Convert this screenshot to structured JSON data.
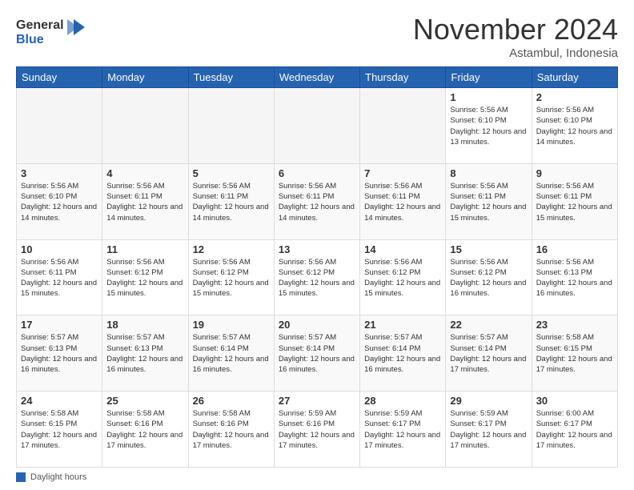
{
  "header": {
    "logo_general": "General",
    "logo_blue": "Blue",
    "month_title": "November 2024",
    "subtitle": "Astambul, Indonesia"
  },
  "days_of_week": [
    "Sunday",
    "Monday",
    "Tuesday",
    "Wednesday",
    "Thursday",
    "Friday",
    "Saturday"
  ],
  "weeks": [
    [
      {
        "day": "",
        "empty": true
      },
      {
        "day": "",
        "empty": true
      },
      {
        "day": "",
        "empty": true
      },
      {
        "day": "",
        "empty": true
      },
      {
        "day": "",
        "empty": true
      },
      {
        "day": "1",
        "sunrise": "Sunrise: 5:56 AM",
        "sunset": "Sunset: 6:10 PM",
        "daylight": "Daylight: 12 hours and 13 minutes."
      },
      {
        "day": "2",
        "sunrise": "Sunrise: 5:56 AM",
        "sunset": "Sunset: 6:10 PM",
        "daylight": "Daylight: 12 hours and 14 minutes."
      }
    ],
    [
      {
        "day": "3",
        "sunrise": "Sunrise: 5:56 AM",
        "sunset": "Sunset: 6:10 PM",
        "daylight": "Daylight: 12 hours and 14 minutes."
      },
      {
        "day": "4",
        "sunrise": "Sunrise: 5:56 AM",
        "sunset": "Sunset: 6:11 PM",
        "daylight": "Daylight: 12 hours and 14 minutes."
      },
      {
        "day": "5",
        "sunrise": "Sunrise: 5:56 AM",
        "sunset": "Sunset: 6:11 PM",
        "daylight": "Daylight: 12 hours and 14 minutes."
      },
      {
        "day": "6",
        "sunrise": "Sunrise: 5:56 AM",
        "sunset": "Sunset: 6:11 PM",
        "daylight": "Daylight: 12 hours and 14 minutes."
      },
      {
        "day": "7",
        "sunrise": "Sunrise: 5:56 AM",
        "sunset": "Sunset: 6:11 PM",
        "daylight": "Daylight: 12 hours and 14 minutes."
      },
      {
        "day": "8",
        "sunrise": "Sunrise: 5:56 AM",
        "sunset": "Sunset: 6:11 PM",
        "daylight": "Daylight: 12 hours and 15 minutes."
      },
      {
        "day": "9",
        "sunrise": "Sunrise: 5:56 AM",
        "sunset": "Sunset: 6:11 PM",
        "daylight": "Daylight: 12 hours and 15 minutes."
      }
    ],
    [
      {
        "day": "10",
        "sunrise": "Sunrise: 5:56 AM",
        "sunset": "Sunset: 6:11 PM",
        "daylight": "Daylight: 12 hours and 15 minutes."
      },
      {
        "day": "11",
        "sunrise": "Sunrise: 5:56 AM",
        "sunset": "Sunset: 6:12 PM",
        "daylight": "Daylight: 12 hours and 15 minutes."
      },
      {
        "day": "12",
        "sunrise": "Sunrise: 5:56 AM",
        "sunset": "Sunset: 6:12 PM",
        "daylight": "Daylight: 12 hours and 15 minutes."
      },
      {
        "day": "13",
        "sunrise": "Sunrise: 5:56 AM",
        "sunset": "Sunset: 6:12 PM",
        "daylight": "Daylight: 12 hours and 15 minutes."
      },
      {
        "day": "14",
        "sunrise": "Sunrise: 5:56 AM",
        "sunset": "Sunset: 6:12 PM",
        "daylight": "Daylight: 12 hours and 15 minutes."
      },
      {
        "day": "15",
        "sunrise": "Sunrise: 5:56 AM",
        "sunset": "Sunset: 6:12 PM",
        "daylight": "Daylight: 12 hours and 16 minutes."
      },
      {
        "day": "16",
        "sunrise": "Sunrise: 5:56 AM",
        "sunset": "Sunset: 6:13 PM",
        "daylight": "Daylight: 12 hours and 16 minutes."
      }
    ],
    [
      {
        "day": "17",
        "sunrise": "Sunrise: 5:57 AM",
        "sunset": "Sunset: 6:13 PM",
        "daylight": "Daylight: 12 hours and 16 minutes."
      },
      {
        "day": "18",
        "sunrise": "Sunrise: 5:57 AM",
        "sunset": "Sunset: 6:13 PM",
        "daylight": "Daylight: 12 hours and 16 minutes."
      },
      {
        "day": "19",
        "sunrise": "Sunrise: 5:57 AM",
        "sunset": "Sunset: 6:14 PM",
        "daylight": "Daylight: 12 hours and 16 minutes."
      },
      {
        "day": "20",
        "sunrise": "Sunrise: 5:57 AM",
        "sunset": "Sunset: 6:14 PM",
        "daylight": "Daylight: 12 hours and 16 minutes."
      },
      {
        "day": "21",
        "sunrise": "Sunrise: 5:57 AM",
        "sunset": "Sunset: 6:14 PM",
        "daylight": "Daylight: 12 hours and 16 minutes."
      },
      {
        "day": "22",
        "sunrise": "Sunrise: 5:57 AM",
        "sunset": "Sunset: 6:14 PM",
        "daylight": "Daylight: 12 hours and 17 minutes."
      },
      {
        "day": "23",
        "sunrise": "Sunrise: 5:58 AM",
        "sunset": "Sunset: 6:15 PM",
        "daylight": "Daylight: 12 hours and 17 minutes."
      }
    ],
    [
      {
        "day": "24",
        "sunrise": "Sunrise: 5:58 AM",
        "sunset": "Sunset: 6:15 PM",
        "daylight": "Daylight: 12 hours and 17 minutes."
      },
      {
        "day": "25",
        "sunrise": "Sunrise: 5:58 AM",
        "sunset": "Sunset: 6:16 PM",
        "daylight": "Daylight: 12 hours and 17 minutes."
      },
      {
        "day": "26",
        "sunrise": "Sunrise: 5:58 AM",
        "sunset": "Sunset: 6:16 PM",
        "daylight": "Daylight: 12 hours and 17 minutes."
      },
      {
        "day": "27",
        "sunrise": "Sunrise: 5:59 AM",
        "sunset": "Sunset: 6:16 PM",
        "daylight": "Daylight: 12 hours and 17 minutes."
      },
      {
        "day": "28",
        "sunrise": "Sunrise: 5:59 AM",
        "sunset": "Sunset: 6:17 PM",
        "daylight": "Daylight: 12 hours and 17 minutes."
      },
      {
        "day": "29",
        "sunrise": "Sunrise: 5:59 AM",
        "sunset": "Sunset: 6:17 PM",
        "daylight": "Daylight: 12 hours and 17 minutes."
      },
      {
        "day": "30",
        "sunrise": "Sunrise: 6:00 AM",
        "sunset": "Sunset: 6:17 PM",
        "daylight": "Daylight: 12 hours and 17 minutes."
      }
    ]
  ],
  "footer": {
    "daylight_label": "Daylight hours"
  }
}
